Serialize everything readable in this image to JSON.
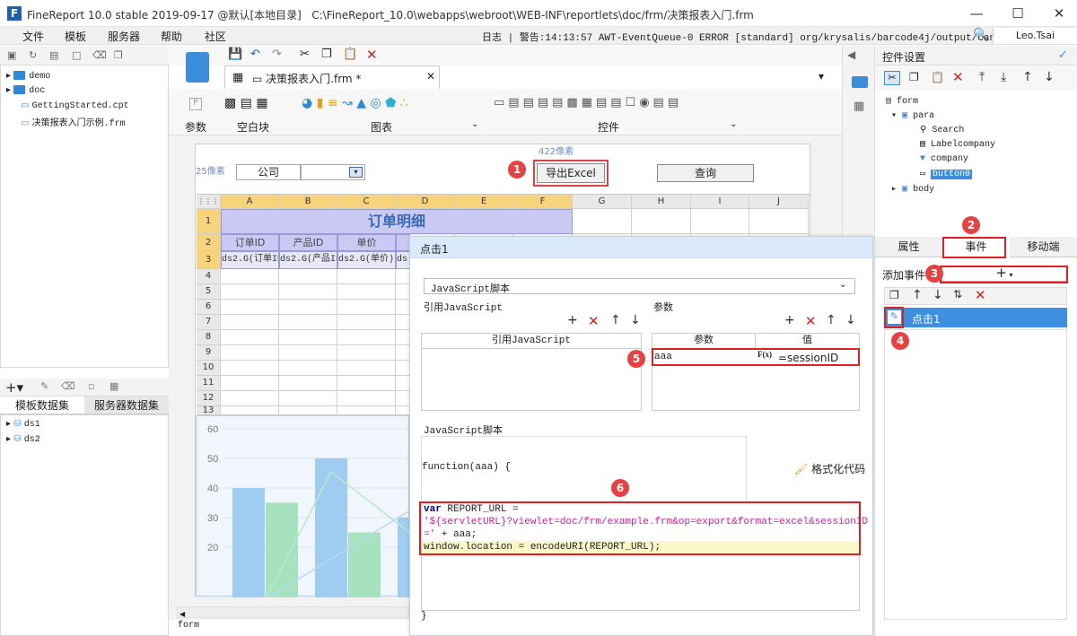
{
  "window": {
    "app_title": "FineReport 10.0 stable 2019-09-17 @默认[本地目录]",
    "path": "C:\\FineReport_10.0\\webapps\\webroot\\WEB-INF\\reportlets\\doc/frm/决策报表入门.frm",
    "minimize": "—",
    "maximize": "☐",
    "close": "✕"
  },
  "menu": [
    "文件",
    "模板",
    "服务器",
    "帮助",
    "社区"
  ],
  "log": "日志 | 警告:14:13:57 AWT-EventQueue-0 ERROR [standard] org/krysalis/barcode4j/output/CanvasProvider",
  "user": "Leo.Tsai",
  "file_tree": [
    {
      "label": "demo",
      "type": "folder"
    },
    {
      "label": "doc",
      "type": "folder"
    },
    {
      "label": "GettingStarted.cpt",
      "type": "file"
    },
    {
      "label": "决策报表入门示例.frm",
      "type": "file"
    }
  ],
  "dataset_tabs": [
    "模板数据集",
    "服务器数据集"
  ],
  "datasets": [
    "ds1",
    "ds2"
  ],
  "doc_tab": "决策报表入门.frm *",
  "ribbon": {
    "param_label": "参数",
    "blank_label": "空白块",
    "chart_label": "图表",
    "widget_label": "控件"
  },
  "canvas": {
    "width_hint": "422像素",
    "height_hint": "25像素",
    "company_label": "公司",
    "export_button": "导出Excel",
    "query_button": "查询",
    "columns": [
      "A",
      "B",
      "C",
      "D",
      "E",
      "F",
      "G",
      "H",
      "I",
      "J"
    ],
    "rows": [
      "1",
      "2",
      "3",
      "4",
      "5",
      "6",
      "7",
      "8",
      "9",
      "10",
      "11",
      "12",
      "13"
    ],
    "report_title": "订单明细",
    "headers": [
      "订单ID",
      "产品ID",
      "单价"
    ],
    "row3": [
      "ds2.G(订单ID)",
      "ds2.G(产品ID)",
      "ds2.G(单价)",
      "ds"
    ],
    "y_ticks": [
      "60",
      "50",
      "40",
      "30",
      "20"
    ],
    "status": "form"
  },
  "chart_data": {
    "type": "bar",
    "y_ticks": [
      60,
      50,
      40,
      30,
      20
    ],
    "series": [
      {
        "color": "#9fcdf2",
        "values": [
          40,
          50,
          30
        ]
      },
      {
        "color": "#a7e2bf",
        "values": [
          35,
          25,
          null
        ]
      }
    ]
  },
  "dialog": {
    "title": "点击1",
    "script_type": "JavaScript脚本",
    "ref_js_title": "引用JavaScript",
    "params_title": "参数",
    "ref_js_col": "引用JavaScript",
    "param_col": "参数",
    "value_col": "值",
    "param_name": "aaa",
    "param_value": "=sessionID",
    "fx_label": "F(x)",
    "script_section": "JavaScript脚本",
    "function_sig": "function(aaa) {",
    "format_code": "格式化代码",
    "code_line1a": "var",
    "code_line1b": " REPORT_URL =",
    "code_line2": "'${servletURL}?viewlet=doc/frm/example.frm&op=export&format=excel&sessionID",
    "code_line3a": "='",
    "code_line3b": " + aaa;",
    "code_line4": "window.location = encodeURI(REPORT_URL);",
    "closing_brace": "}"
  },
  "right_panel": {
    "title": "控件设置",
    "tree": [
      "form",
      "para",
      "Search",
      "Labelcompany",
      "company",
      "button0",
      "body"
    ],
    "tabs": [
      "属性",
      "事件",
      "移动端"
    ],
    "add_event": "添加事件",
    "add_symbol": "+",
    "event_item": "点击1"
  },
  "badges": [
    "1",
    "2",
    "3",
    "4",
    "5",
    "6"
  ],
  "colors": {
    "accent": "#3c8ddc",
    "highlight": "#e02020",
    "selected_row": "#3d8fe0",
    "title_cell": "#c9c9f4"
  }
}
